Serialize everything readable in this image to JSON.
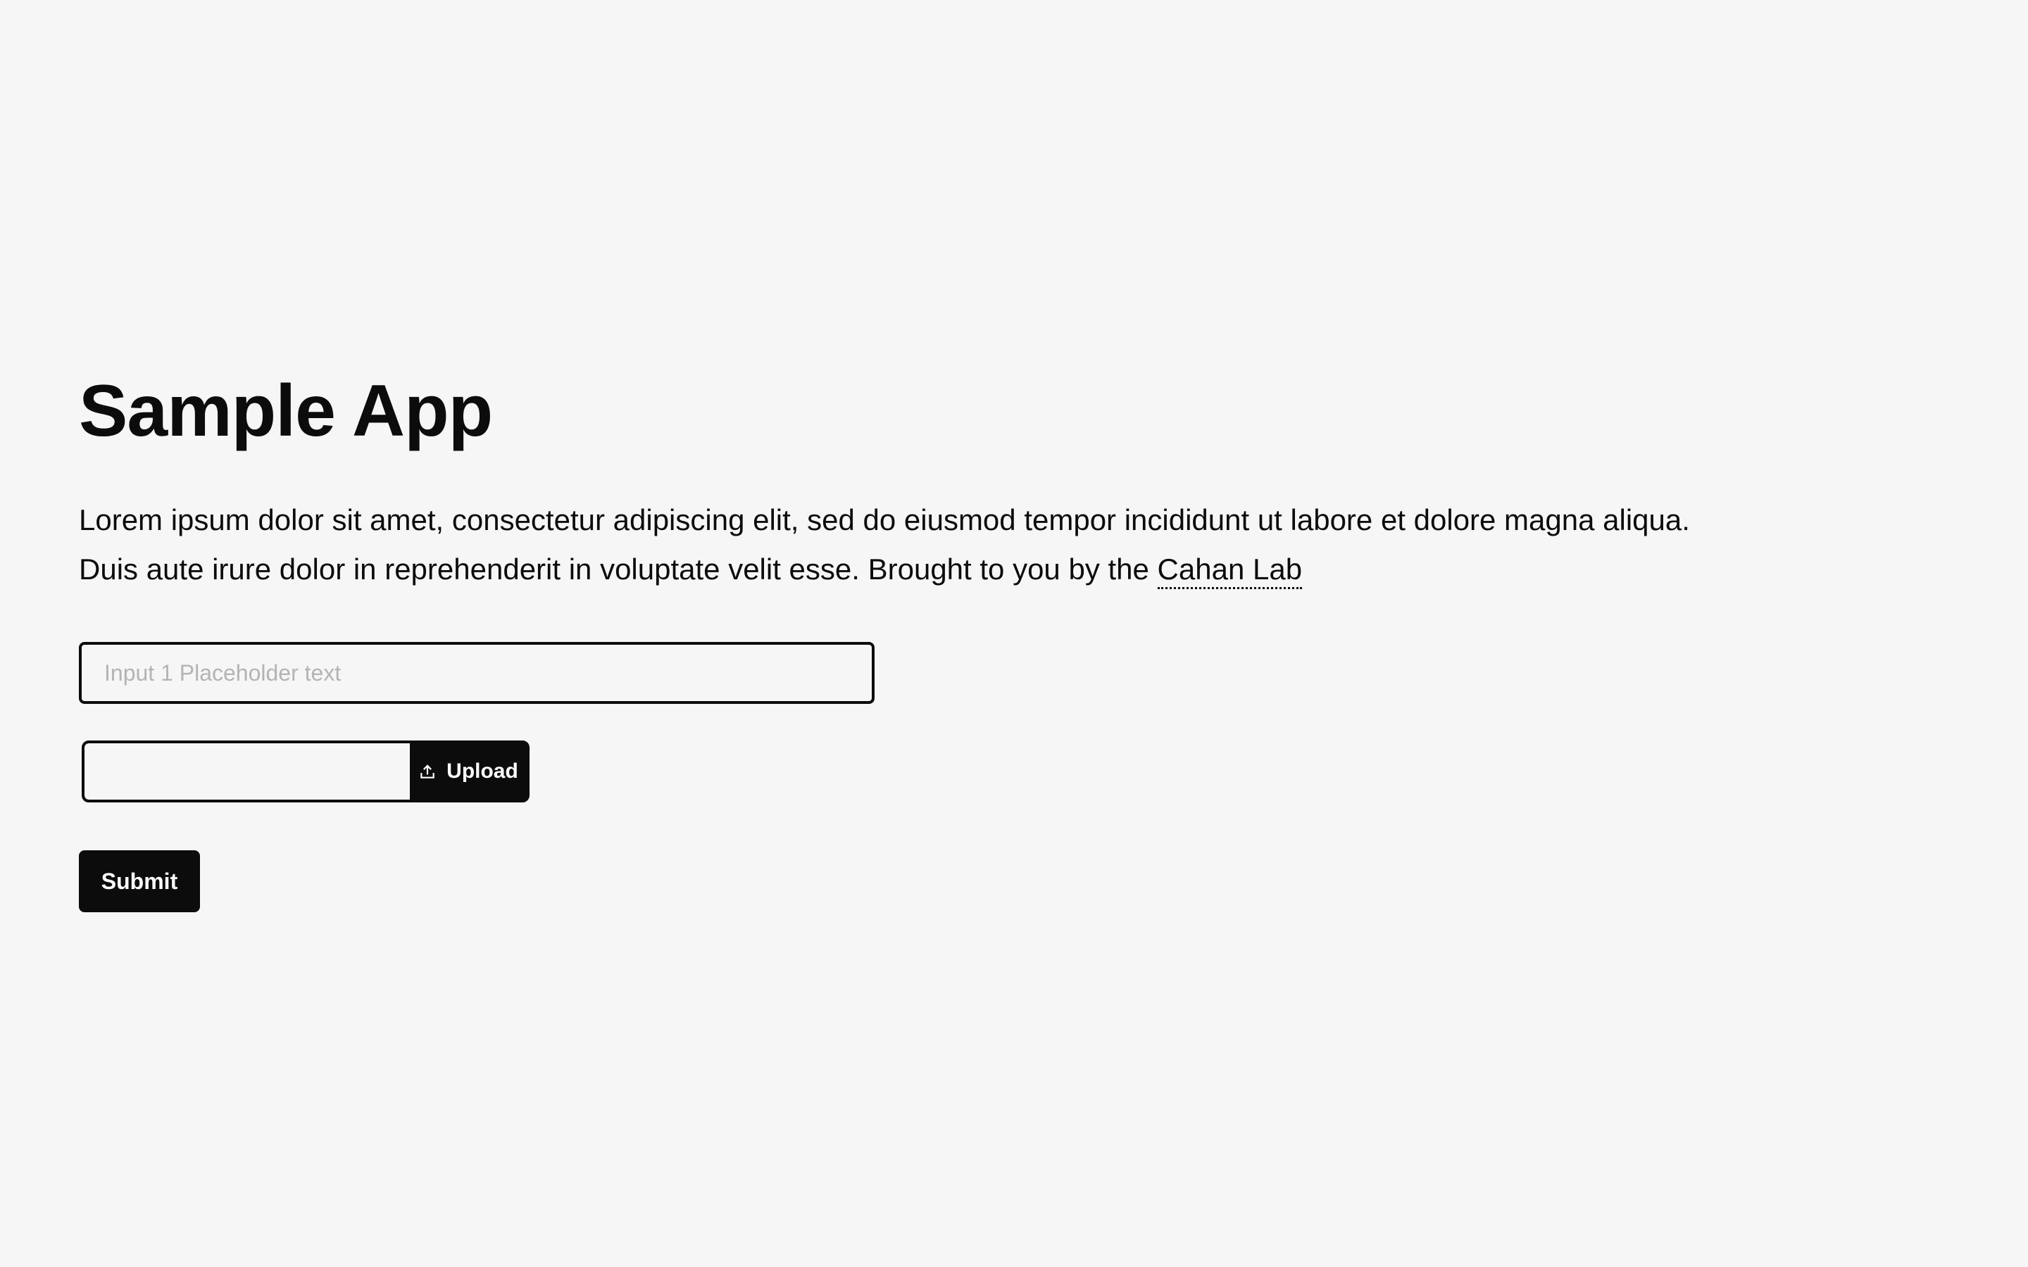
{
  "app": {
    "title": "Sample App"
  },
  "description": {
    "line1": "Lorem ipsum dolor sit amet, consectetur adipiscing elit, sed do eiusmod tempor incididunt ut labore et dolore magna aliqua.",
    "line2_prefix": "Duis aute irure dolor in reprehenderit in voluptate velit esse. Brought to you by the ",
    "link_text": "Cahan Lab"
  },
  "form": {
    "input1": {
      "placeholder": "Input 1 Placeholder text",
      "value": ""
    },
    "upload": {
      "button_label": "Upload",
      "icon": "upload-icon"
    },
    "submit_label": "Submit"
  },
  "colors": {
    "background": "#f6f6f6",
    "text": "#0c0c0c",
    "button_background": "#0c0c0c",
    "button_text": "#ffffff",
    "placeholder": "#b4b4b4"
  }
}
